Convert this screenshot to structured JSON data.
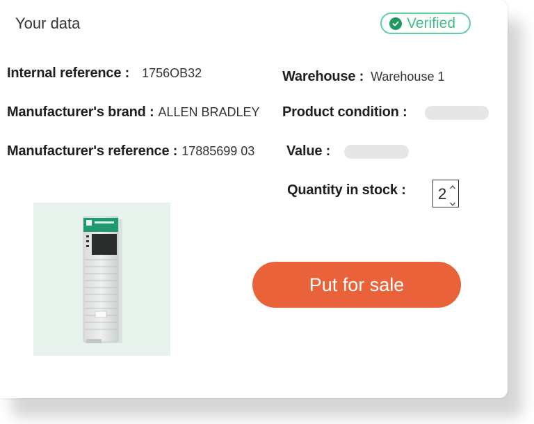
{
  "card": {
    "title": "Your data",
    "badge": {
      "label": "Verified",
      "icon": "check-circle-icon",
      "color": "#3fbf86"
    }
  },
  "fields": {
    "internal_reference": {
      "label": "Internal reference :",
      "value": "1756OB32"
    },
    "manufacturer_brand": {
      "label": "Manufacturer's brand :",
      "value": "ALLEN BRADLEY"
    },
    "manufacturer_reference": {
      "label": "Manufacturer's reference :",
      "value": "17885699 03"
    },
    "warehouse": {
      "label": "Warehouse :",
      "value": "Warehouse 1"
    },
    "product_condition": {
      "label": "Product condition :"
    },
    "value": {
      "label": "Value :"
    },
    "quantity_in_stock": {
      "label": "Quantity in stock :",
      "value": "2"
    }
  },
  "actions": {
    "put_for_sale": "Put for sale",
    "color": "#e9623a"
  }
}
